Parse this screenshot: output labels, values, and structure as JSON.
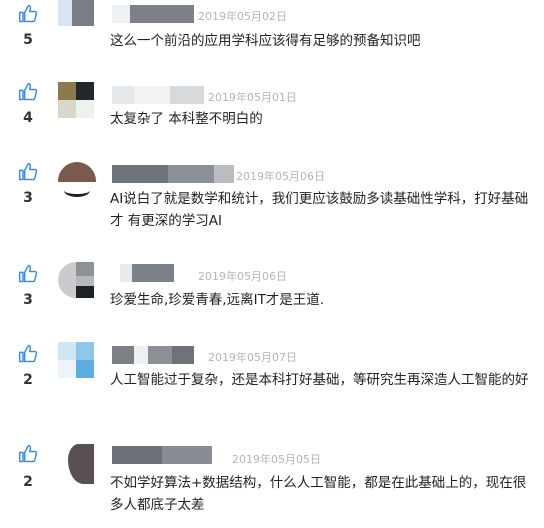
{
  "colors": {
    "accent": "#3a8ee6",
    "count_text": "#333333",
    "date_text": "#b5b5b5",
    "body_text": "#222222"
  },
  "comments": [
    {
      "likes": "5",
      "date": "2019年05月02日",
      "text": "这么一个前沿的应用学科应该得有足够的预备知识吧"
    },
    {
      "likes": "4",
      "date": "2019年05月01日",
      "text": "太复杂了 本科整不明白的"
    },
    {
      "likes": "3",
      "date": "2019年05月06日",
      "text": "AI说白了就是数学和统计，我们更应该鼓励多读基础性学科，打好基础才 有更深的学习AI"
    },
    {
      "likes": "3",
      "date": "2019年05月06日",
      "text": "珍爱生命,珍爱青春,远离IT才是王道."
    },
    {
      "likes": "2",
      "date": "2019年05月07日",
      "text": "人工智能过于复杂，还是本科打好基础，等研究生再深造人工智能的好"
    },
    {
      "likes": "2",
      "date": "2019年05月05日",
      "text": "不如学好算法+数据结构，什么人工智能，都是在此基础上的，现在很多人都底子太差"
    }
  ],
  "icons": {
    "like": "thumbs-up-icon"
  }
}
